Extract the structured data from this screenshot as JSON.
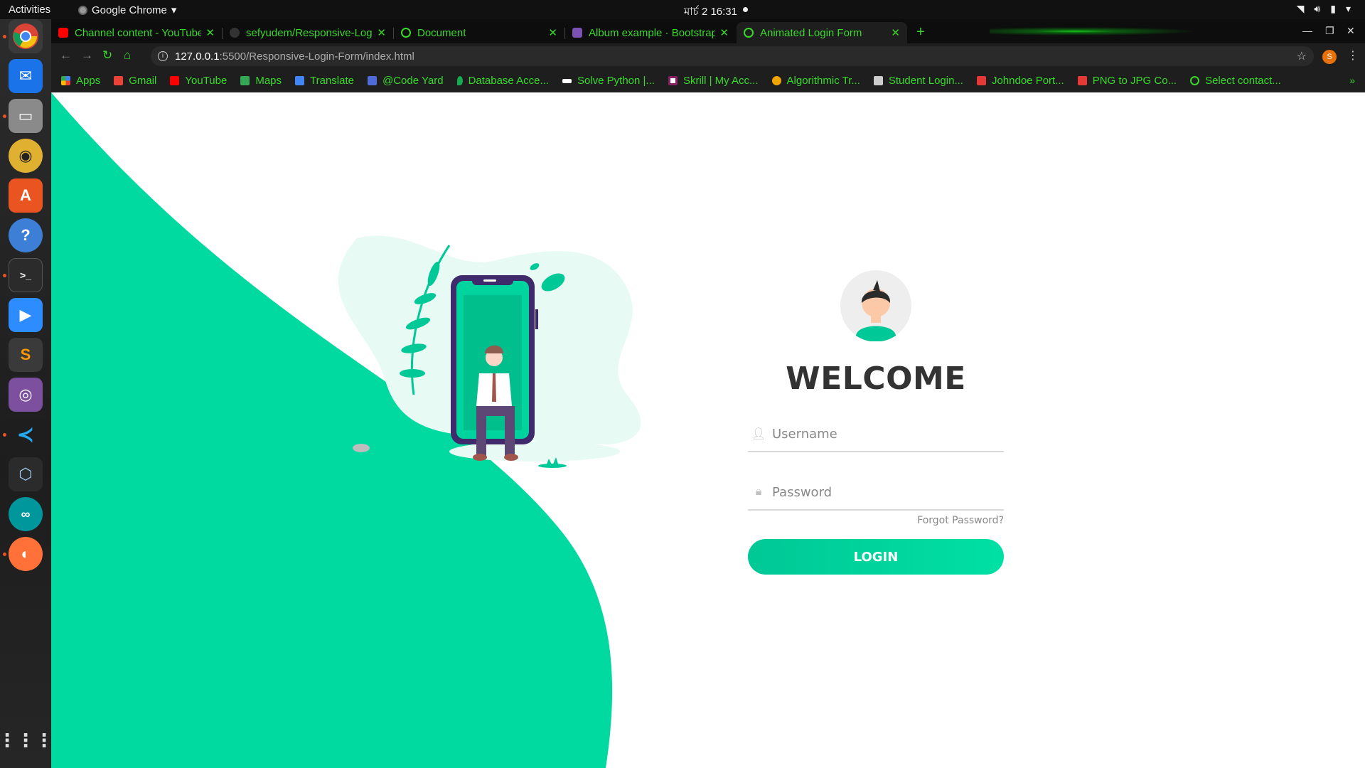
{
  "system_bar": {
    "activities": "Activities",
    "app_name": "Google Chrome",
    "clock": "মার্চ 2  16:31"
  },
  "dock": {
    "apps": [
      {
        "name": "chrome-icon"
      },
      {
        "name": "thunderbird-icon"
      },
      {
        "name": "files-icon"
      },
      {
        "name": "rhythmbox-icon"
      },
      {
        "name": "software-center-icon"
      },
      {
        "name": "help-icon"
      },
      {
        "name": "terminal-icon"
      },
      {
        "name": "zoom-icon"
      },
      {
        "name": "sublime-icon"
      },
      {
        "name": "video-icon"
      },
      {
        "name": "vscode-icon"
      },
      {
        "name": "virtualbox-icon"
      },
      {
        "name": "arduino-icon"
      },
      {
        "name": "firefox-icon"
      }
    ]
  },
  "tabs": [
    {
      "title": "Channel content - YouTube",
      "favicon_color": "#ff0000"
    },
    {
      "title": "sefyudem/Responsive-Login-Form",
      "favicon_color": "#333333"
    },
    {
      "title": "Document",
      "favicon_color": "#39d82b"
    },
    {
      "title": "Album example · Bootstrap",
      "favicon_color": "#7952b3"
    },
    {
      "title": "Animated Login Form",
      "favicon_color": "#39d82b"
    }
  ],
  "address_bar": {
    "host": "127.0.0.1",
    "path": ":5500/Responsive-Login-Form/index.html"
  },
  "profile_initial": "S",
  "bookmarks": [
    {
      "label": "Apps",
      "color": "#4285f4"
    },
    {
      "label": "Gmail",
      "color": "#ea4335"
    },
    {
      "label": "YouTube",
      "color": "#ff0000"
    },
    {
      "label": "Maps",
      "color": "#34a853"
    },
    {
      "label": "Translate",
      "color": "#4285f4"
    },
    {
      "label": "@Code Yard",
      "color": "#4f6bd8"
    },
    {
      "label": "Database Acce...",
      "color": "#13aa52"
    },
    {
      "label": "Solve Python |...",
      "color": "#ffffff"
    },
    {
      "label": "Skrill | My Acc...",
      "color": "#862165"
    },
    {
      "label": "Algorithmic Tr...",
      "color": "#f0a500"
    },
    {
      "label": "Student Login...",
      "color": "#cccccc"
    },
    {
      "label": "Johndoe Port...",
      "color": "#e53935"
    },
    {
      "label": "PNG to JPG Co...",
      "color": "#e53935"
    },
    {
      "label": "Select contact...",
      "color": "#39d82b"
    }
  ],
  "login": {
    "heading": "WELCOME",
    "username_placeholder": "Username",
    "password_placeholder": "Password",
    "forgot": "Forgot Password?",
    "button": "LOGIN"
  },
  "colors": {
    "accent": "#00d69f",
    "tab_text": "#39d82b"
  }
}
